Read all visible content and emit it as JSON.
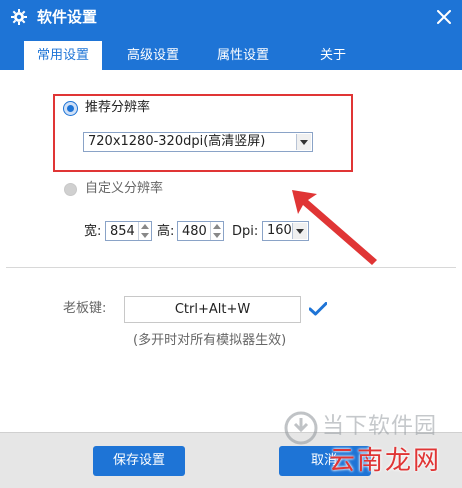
{
  "window": {
    "title": "软件设置",
    "title_icon": "gear-icon",
    "close_icon": "close-icon"
  },
  "tabs": [
    {
      "label": "常用设置",
      "active": true
    },
    {
      "label": "高级设置",
      "active": false
    },
    {
      "label": "属性设置",
      "active": false
    },
    {
      "label": "关于",
      "active": false
    }
  ],
  "resolution": {
    "recommended_label": "推荐分辨率",
    "recommended_selected": true,
    "recommended_value": "720x1280-320dpi(高清竖屏)",
    "custom_label": "自定义分辨率",
    "custom_selected": false,
    "width_label": "宽:",
    "width_value": "854",
    "height_label": "高:",
    "height_value": "480",
    "dpi_label": "Dpi:",
    "dpi_value": "160"
  },
  "boss_key": {
    "label": "老板键:",
    "value": "Ctrl+Alt+W",
    "note": "(多开时对所有模拟器生效)",
    "confirm_icon": "checkmark-icon"
  },
  "footer": {
    "save_label": "保存设置",
    "cancel_label": "取消"
  },
  "watermark": {
    "top_text": "当下软件园",
    "bottom_text": "云南龙网"
  },
  "colors": {
    "primary": "#1e74d6",
    "highlight": "#e03535",
    "check": "#1e74d6"
  }
}
